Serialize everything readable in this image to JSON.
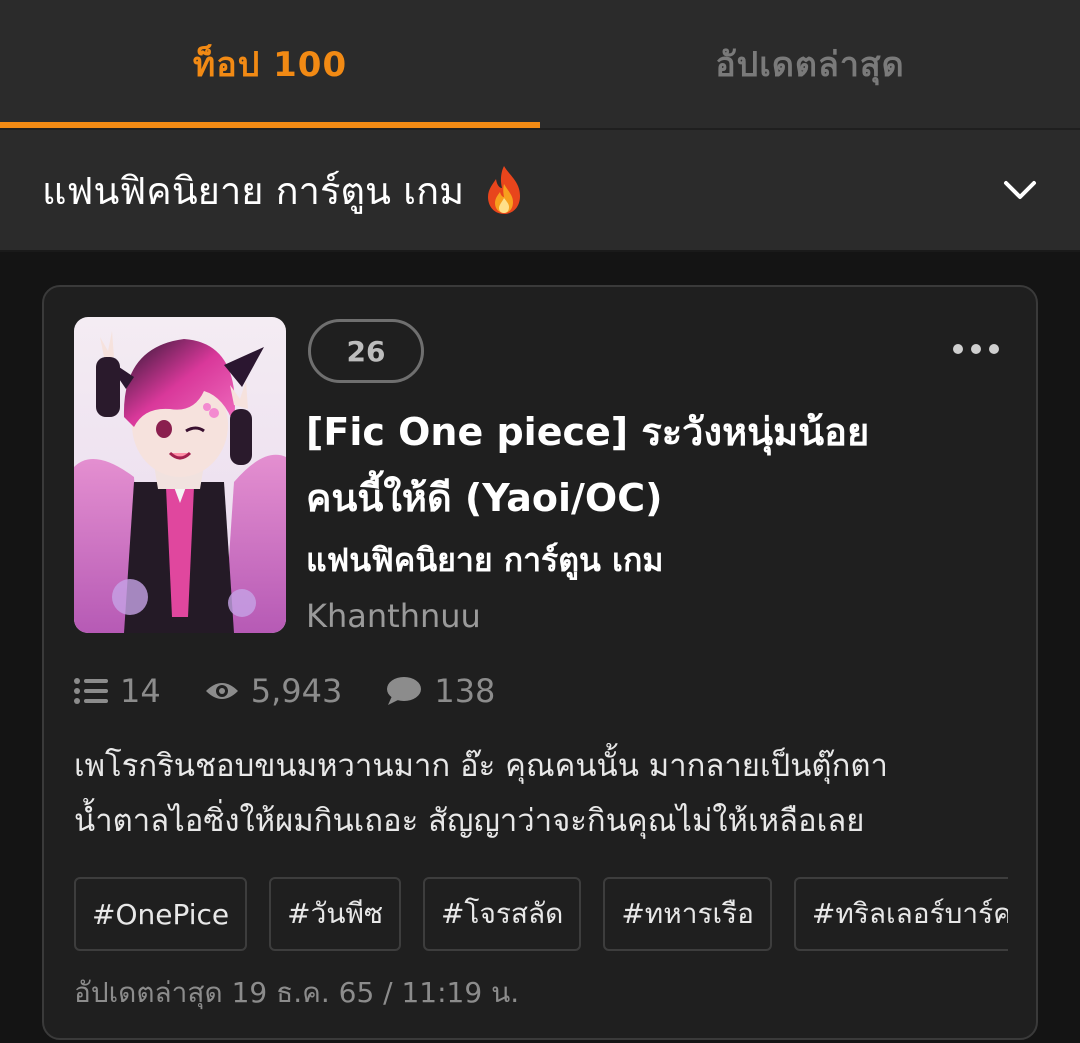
{
  "tabs": [
    {
      "label": "ท็อป 100",
      "active": true
    },
    {
      "label": "อัปเดตล่าสุด",
      "active": false
    }
  ],
  "category_bar": {
    "title": "แฟนฟิคนิยาย การ์ตูน เกม",
    "icon": "fire-icon",
    "toggle_icon": "chevron-down-icon"
  },
  "story": {
    "rank": "26",
    "title_line1": "[Fic One piece] ระวังหนุ่มน้อย",
    "title_line2": "คนนี้ให้ดี (Yaoi/OC)",
    "category": "แฟนฟิคนิยาย การ์ตูน เกม",
    "author": "Khanthnuu",
    "stats": {
      "chapters": "14",
      "views": "5,943",
      "comments": "138"
    },
    "synopsis_line1": "เพโรกรินชอบขนมหวานมาก อ๊ะ คุณคนนั้น มากลายเป็นตุ๊กตา",
    "synopsis_line2": "น้ำตาลไอซิ่งให้ผมกินเถอะ สัญญาว่าจะกินคุณไม่ให้เหลือเลย",
    "tags": [
      "#OnePice",
      "#วันพีซ",
      "#โจรสลัด",
      "#ทหารเรือ",
      "#ทริลเลอร์บาร์ค"
    ],
    "updated": "อัปเดตล่าสุด 19 ธ.ค. 65 / 11:19 น."
  },
  "colors": {
    "accent": "#f28a14",
    "background": "#141414",
    "panel": "#2b2b2b",
    "card": "#1f1f1f"
  }
}
